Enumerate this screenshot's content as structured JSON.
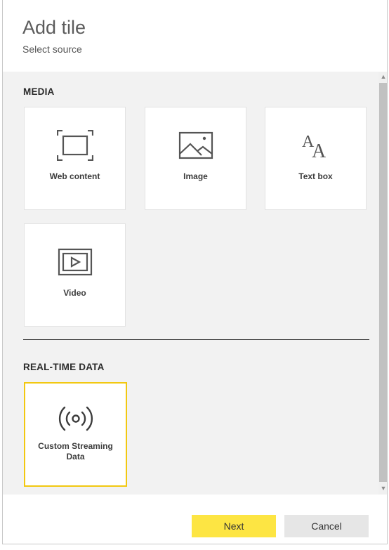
{
  "dialog": {
    "title": "Add tile",
    "subtitle": "Select source"
  },
  "sections": {
    "media": {
      "label": "MEDIA",
      "tiles": [
        {
          "label": "Web content",
          "icon": "web-content-icon"
        },
        {
          "label": "Image",
          "icon": "image-icon"
        },
        {
          "label": "Text box",
          "icon": "text-box-icon"
        },
        {
          "label": "Video",
          "icon": "video-icon"
        }
      ]
    },
    "realtime": {
      "label": "REAL-TIME DATA",
      "tiles": [
        {
          "label": "Custom Streaming Data",
          "icon": "streaming-data-icon",
          "selected": true
        }
      ]
    }
  },
  "footer": {
    "next_label": "Next",
    "cancel_label": "Cancel"
  },
  "colors": {
    "accent": "#f2c811",
    "next_button": "#fde543",
    "cancel_button": "#e6e6e6",
    "content_bg": "#f2f2f2"
  }
}
